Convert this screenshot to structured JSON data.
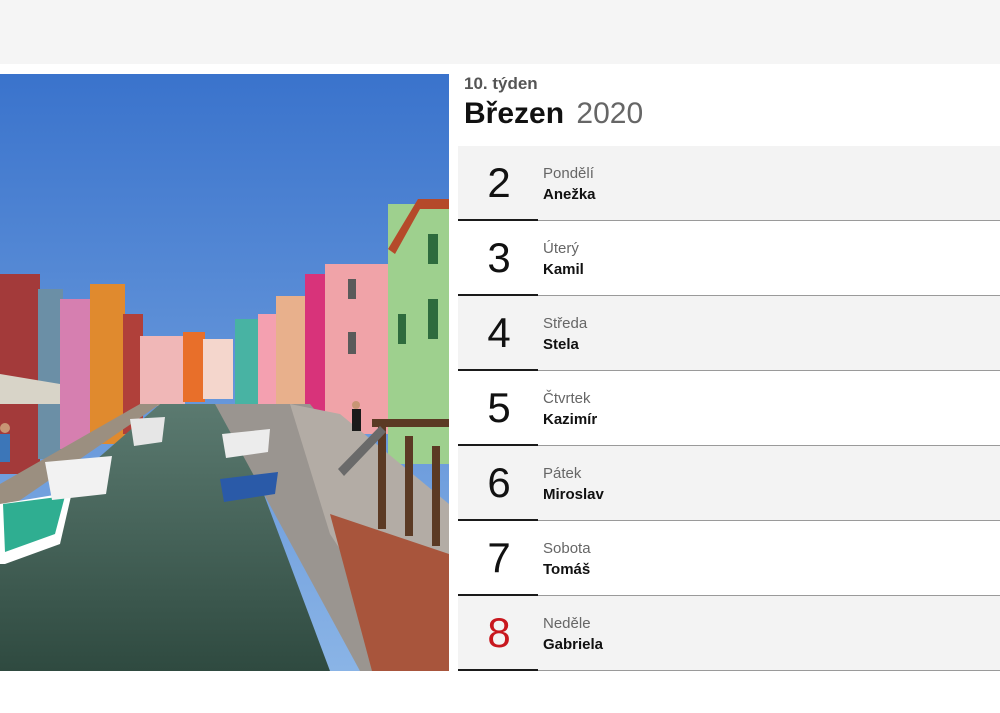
{
  "calendar": {
    "week_label": "10. týden",
    "month": "Březen",
    "year": "2020",
    "days": [
      {
        "number": "2",
        "weekday": "Pondělí",
        "nameday": "Anežka",
        "sunday": false
      },
      {
        "number": "3",
        "weekday": "Úterý",
        "nameday": "Kamil",
        "sunday": false
      },
      {
        "number": "4",
        "weekday": "Středa",
        "nameday": "Stela",
        "sunday": false
      },
      {
        "number": "5",
        "weekday": "Čtvrtek",
        "nameday": "Kazimír",
        "sunday": false
      },
      {
        "number": "6",
        "weekday": "Pátek",
        "nameday": "Miroslav",
        "sunday": false
      },
      {
        "number": "7",
        "weekday": "Sobota",
        "nameday": "Tomáš",
        "sunday": false
      },
      {
        "number": "8",
        "weekday": "Neděle",
        "nameday": "Gabriela",
        "sunday": true
      }
    ]
  },
  "colors": {
    "sunday_number": "#c8171e",
    "sky": "#3f7fd0",
    "canal_water": "#3d5a4e"
  }
}
